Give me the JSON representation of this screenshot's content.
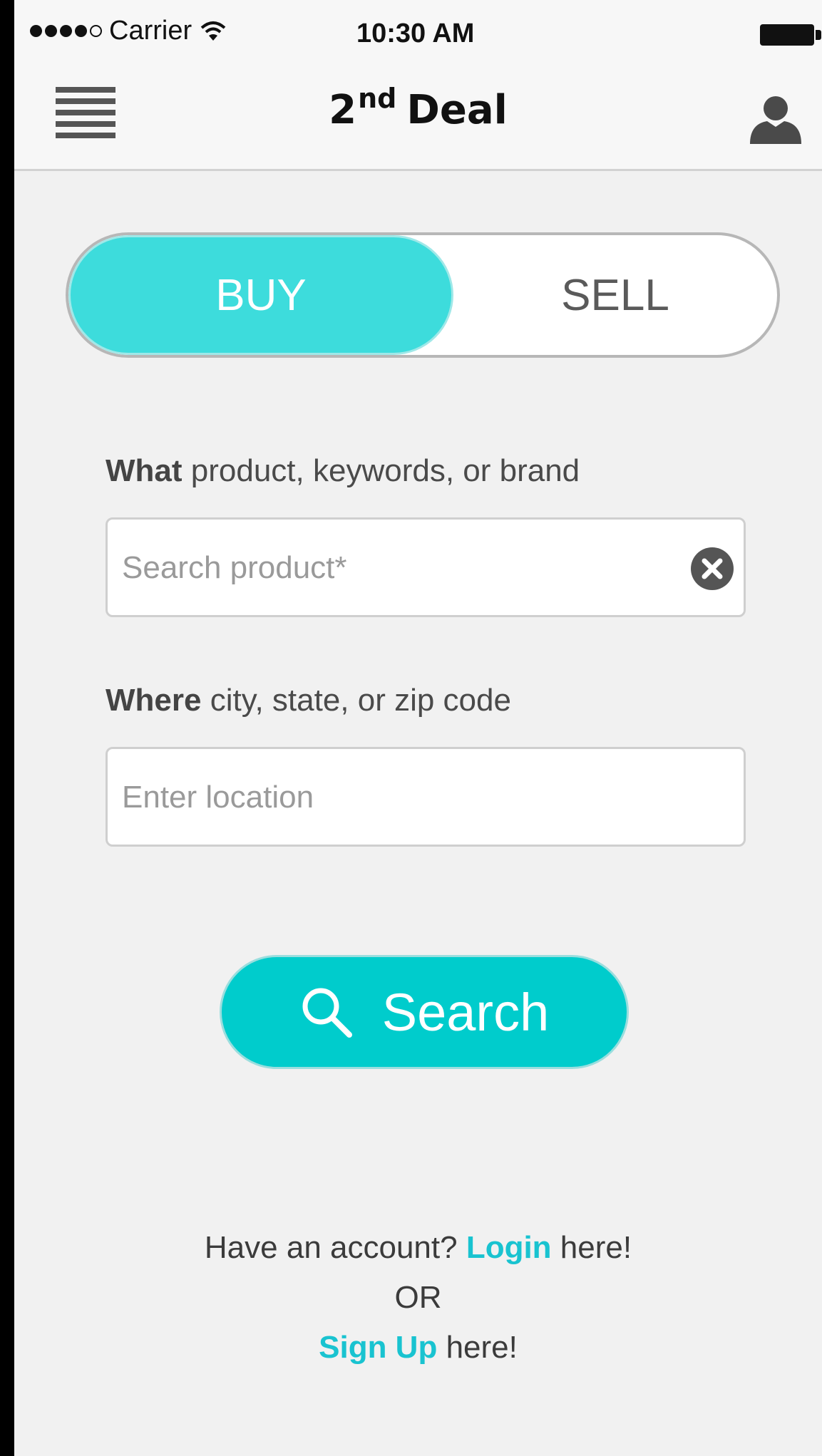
{
  "status_bar": {
    "carrier": "Carrier",
    "time": "10:30 AM"
  },
  "nav": {
    "title_main": "2",
    "title_sup": "nd",
    "title_rest": "Deal",
    "menu_icon": "hamburger-menu-icon",
    "user_icon": "user-profile-icon"
  },
  "toggle": {
    "buy_label": "BUY",
    "sell_label": "SELL",
    "selected": "BUY",
    "active_color": "#3ddcdc"
  },
  "what": {
    "label_bold": "What",
    "label_rest": "product, keywords, or brand",
    "placeholder": "Search product*",
    "value": ""
  },
  "where": {
    "label_bold": "Where",
    "label_rest": "city, state, or zip code",
    "placeholder": "Enter location",
    "value": ""
  },
  "search_button": {
    "label": "Search",
    "color": "#00cccc"
  },
  "footer": {
    "have_account": "Have an account?",
    "login_link": "Login",
    "login_suffix": "here!",
    "or": "OR",
    "signup_link": "Sign Up",
    "signup_suffix": "here!",
    "link_color": "#19c3d0"
  }
}
